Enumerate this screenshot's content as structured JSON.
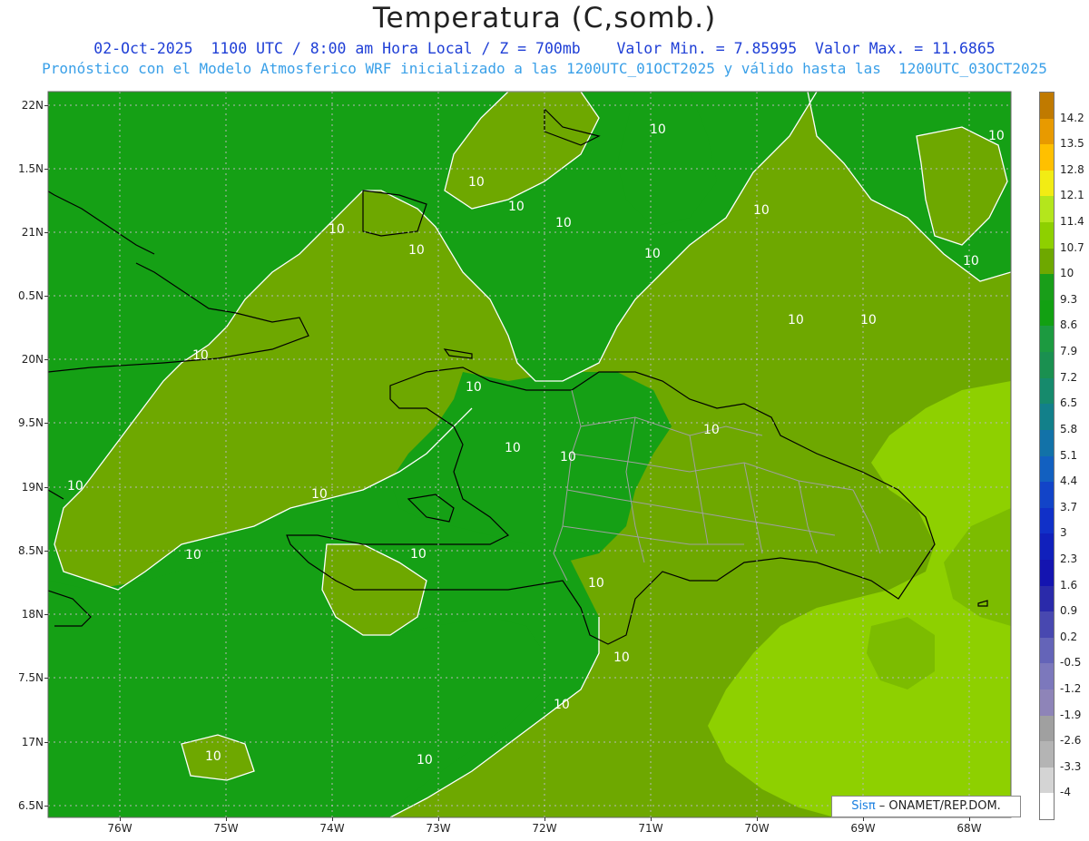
{
  "title": "Temperatura (C,somb.)",
  "subtitle_line1": "02-Oct-2025  1100 UTC / 8:00 am Hora Local / Z = 700mb    Valor Min. = 7.85995  Valor Max. = 11.6865",
  "subtitle_line2": "Pronóstico con el Modelo Atmosferico WRF inicializado a las 1200UTC_01OCT2025 y válido hasta las  1200UTC_03OCT2025",
  "credit": {
    "sis": "Sisπ",
    "rest": " – ONAMET/REP.DOM."
  },
  "lat_labels": [
    "22N",
    "1.5N",
    "21N",
    "0.5N",
    "20N",
    "9.5N",
    "19N",
    "8.5N",
    "18N",
    "7.5N",
    "17N",
    "6.5N"
  ],
  "lon_labels": [
    "76W",
    "75W",
    "74W",
    "73W",
    "72W",
    "71W",
    "70W",
    "69W",
    "68W"
  ],
  "legend": [
    {
      "label": "14.2",
      "color": "#c07a00"
    },
    {
      "label": "13.5",
      "color": "#e89a00"
    },
    {
      "label": "12.8",
      "color": "#ffc000"
    },
    {
      "label": "12.1",
      "color": "#f2ec14"
    },
    {
      "label": "11.4",
      "color": "#b4e61c"
    },
    {
      "label": "10.7",
      "color": "#8ed000"
    },
    {
      "label": "10",
      "color": "#6ea800"
    },
    {
      "label": "9.3",
      "color": "#199e19"
    },
    {
      "label": "8.6",
      "color": "#12a012"
    },
    {
      "label": "7.9",
      "color": "#1c9a40"
    },
    {
      "label": "7.2",
      "color": "#1a9050"
    },
    {
      "label": "6.5",
      "color": "#168a6c"
    },
    {
      "label": "5.8",
      "color": "#12808a"
    },
    {
      "label": "5.1",
      "color": "#1272a8"
    },
    {
      "label": "4.4",
      "color": "#1260c0"
    },
    {
      "label": "3.7",
      "color": "#1244c8"
    },
    {
      "label": "3",
      "color": "#1030c8"
    },
    {
      "label": "2.3",
      "color": "#1020bc"
    },
    {
      "label": "1.6",
      "color": "#1414b0"
    },
    {
      "label": "0.9",
      "color": "#2a2aaa"
    },
    {
      "label": "0.2",
      "color": "#4848b0"
    },
    {
      "label": "-0.5",
      "color": "#6464b8"
    },
    {
      "label": "-1.2",
      "color": "#7c78bc"
    },
    {
      "label": "-1.9",
      "color": "#8e84b8"
    },
    {
      "label": "-2.6",
      "color": "#a0a0a0"
    },
    {
      "label": "-3.3",
      "color": "#b4b4b4"
    },
    {
      "label": "-4",
      "color": "#d4d4d4"
    },
    {
      "label": "",
      "color": "#ffffff"
    }
  ],
  "contour_label": "10",
  "colors": {
    "dark_green": "#15a015",
    "olive_green": "#6ea800",
    "light_green": "#8ed000",
    "mid_green": "#7cbc00",
    "contour": "#ffffff",
    "coast": "#000000",
    "borders": "#a0a0a0"
  }
}
